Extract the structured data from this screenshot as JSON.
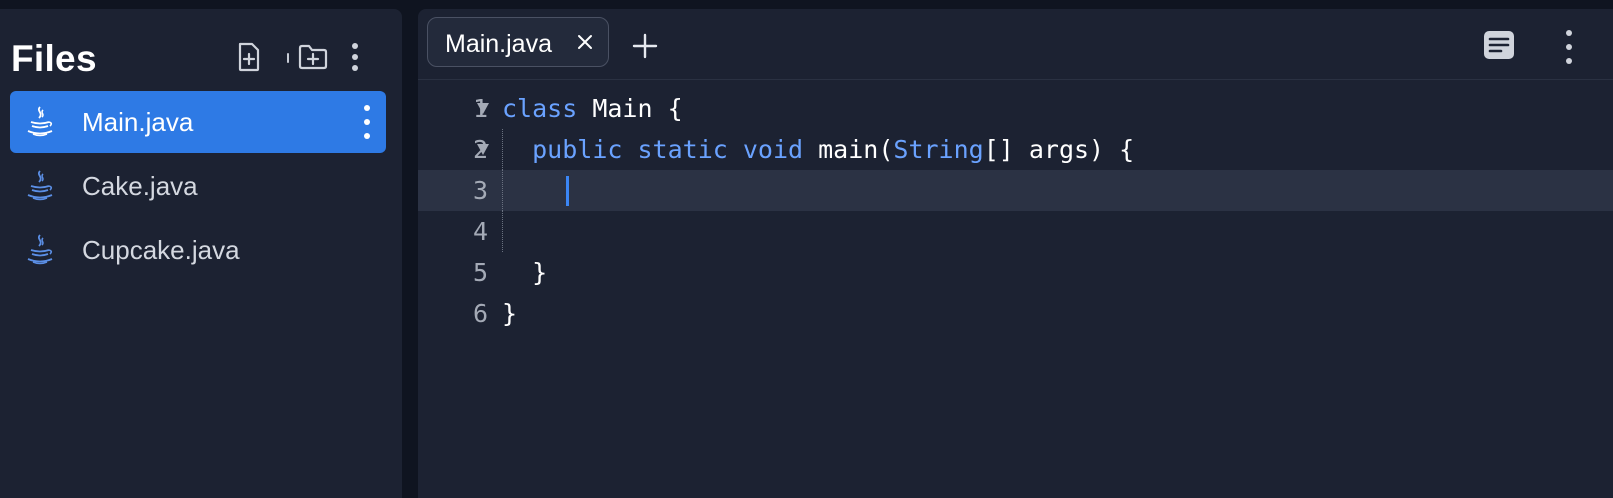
{
  "sidebar": {
    "title": "Files",
    "actions": [
      "new-file",
      "new-folder",
      "more"
    ],
    "files": [
      {
        "name": "Main.java",
        "active": true
      },
      {
        "name": "Cake.java",
        "active": false
      },
      {
        "name": "Cupcake.java",
        "active": false
      }
    ]
  },
  "editor": {
    "tabs": [
      {
        "label": "Main.java",
        "active": true
      }
    ],
    "current_line": 3,
    "lines": [
      {
        "number": "1",
        "fold": true,
        "tokens": [
          {
            "t": "class",
            "kw": true
          },
          {
            "t": " Main {",
            "kw": false
          }
        ]
      },
      {
        "number": "2",
        "fold": true,
        "tokens": [
          {
            "t": "  ",
            "kw": false
          },
          {
            "t": "public",
            "kw": true
          },
          {
            "t": " ",
            "kw": false
          },
          {
            "t": "static",
            "kw": true
          },
          {
            "t": " ",
            "kw": false
          },
          {
            "t": "void",
            "kw": true
          },
          {
            "t": " main(",
            "kw": false
          },
          {
            "t": "String",
            "kw": true
          },
          {
            "t": "[] args) {",
            "kw": false
          }
        ]
      },
      {
        "number": "3",
        "fold": false,
        "tokens": []
      },
      {
        "number": "4",
        "fold": false,
        "tokens": []
      },
      {
        "number": "5",
        "fold": false,
        "tokens": [
          {
            "t": "  }",
            "kw": false
          }
        ]
      },
      {
        "number": "6",
        "fold": false,
        "tokens": [
          {
            "t": "}",
            "kw": false
          }
        ]
      }
    ]
  },
  "colors": {
    "accent": "#2e7ae5",
    "keyword": "#6aa2ff",
    "panel": "#1c2232",
    "background": "#0f1420"
  },
  "icons": [
    "new-file-icon",
    "new-folder-icon",
    "more-vertical-icon",
    "java-file-icon",
    "close-icon",
    "plus-icon",
    "document-icon"
  ]
}
